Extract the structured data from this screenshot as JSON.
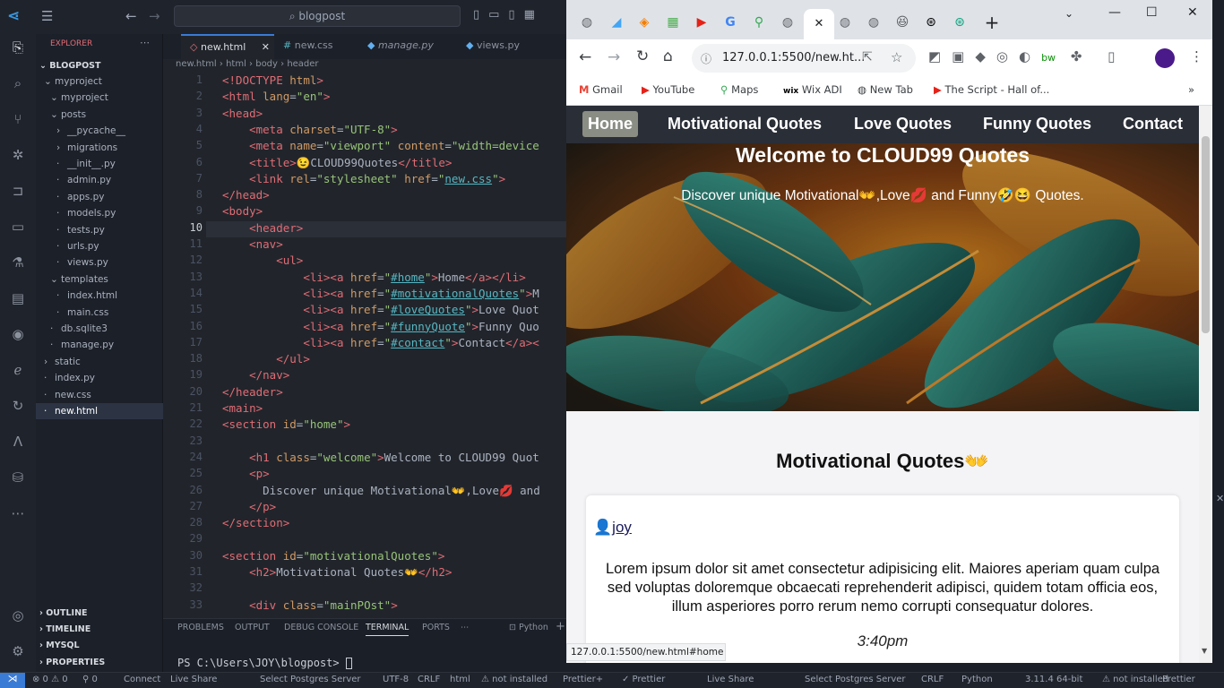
{
  "vscode": {
    "tabs": [
      "new.html",
      "new.css",
      "manage.py",
      "views.py"
    ],
    "breadcrumb": [
      "new.html",
      "html",
      "body",
      "header"
    ],
    "explorer_title": "EXPLORER",
    "project": "BLOGPOST",
    "tree": [
      "myproject",
      "myproject",
      "posts",
      "__pycache__",
      "migrations",
      "__init__.py",
      "admin.py",
      "apps.py",
      "models.py",
      "tests.py",
      "urls.py",
      "views.py",
      "templates",
      "index.html",
      "main.css",
      "db.sqlite3",
      "manage.py",
      "static",
      "index.py",
      "new.css",
      "new.html"
    ],
    "sections": [
      "OUTLINE",
      "TIMELINE",
      "MYSQL",
      "PROPERTIES"
    ],
    "panel_tabs": [
      "PROBLEMS",
      "OUTPUT",
      "DEBUG CONSOLE",
      "TERMINAL",
      "PORTS"
    ],
    "terminal_shell": "Python",
    "terminal_prompt": "PS C:\\Users\\JOY\\blogpost> ",
    "code": [
      {
        "n": "1",
        "t": [
          [
            "tg",
            "<!DOCTYPE "
          ],
          [
            "at",
            "html"
          ],
          [
            "tg",
            ">"
          ]
        ]
      },
      {
        "n": "2",
        "t": [
          [
            "tg",
            "<html "
          ],
          [
            "at",
            "lang"
          ],
          [
            "tx",
            "="
          ],
          [
            "st",
            "\"en\""
          ],
          [
            "tg",
            ">"
          ]
        ]
      },
      {
        "n": "3",
        "t": [
          [
            "tg",
            "<head>"
          ]
        ]
      },
      {
        "n": "4",
        "t": [
          [
            "tx",
            "    "
          ],
          [
            "tg",
            "<meta "
          ],
          [
            "at",
            "charset"
          ],
          [
            "tx",
            "="
          ],
          [
            "st",
            "\"UTF-8\""
          ],
          [
            "tg",
            ">"
          ]
        ]
      },
      {
        "n": "5",
        "t": [
          [
            "tx",
            "    "
          ],
          [
            "tg",
            "<meta "
          ],
          [
            "at",
            "name"
          ],
          [
            "tx",
            "="
          ],
          [
            "st",
            "\"viewport\""
          ],
          [
            "tx",
            " "
          ],
          [
            "at",
            "content"
          ],
          [
            "tx",
            "="
          ],
          [
            "st",
            "\"width=device"
          ]
        ]
      },
      {
        "n": "6",
        "t": [
          [
            "tx",
            "    "
          ],
          [
            "tg",
            "<title>"
          ],
          [
            "tx",
            "😉CLOUD99Quotes"
          ],
          [
            "tg",
            "</title>"
          ]
        ]
      },
      {
        "n": "7",
        "t": [
          [
            "tx",
            "    "
          ],
          [
            "tg",
            "<link "
          ],
          [
            "at",
            "rel"
          ],
          [
            "tx",
            "="
          ],
          [
            "st",
            "\"stylesheet\""
          ],
          [
            "tx",
            " "
          ],
          [
            "at",
            "href"
          ],
          [
            "tx",
            "="
          ],
          [
            "st",
            "\""
          ],
          [
            "lk",
            "new.css"
          ],
          [
            "st",
            "\""
          ],
          [
            "tg",
            ">"
          ]
        ]
      },
      {
        "n": "8",
        "t": [
          [
            "tg",
            "</head>"
          ]
        ]
      },
      {
        "n": "9",
        "t": [
          [
            "tg",
            "<body>"
          ]
        ]
      },
      {
        "n": "10",
        "t": [
          [
            "tx",
            "    "
          ],
          [
            "tg",
            "<header>"
          ]
        ],
        "cur": true
      },
      {
        "n": "11",
        "t": [
          [
            "tx",
            "    "
          ],
          [
            "tg",
            "<nav>"
          ]
        ]
      },
      {
        "n": "12",
        "t": [
          [
            "tx",
            "        "
          ],
          [
            "tg",
            "<ul>"
          ]
        ]
      },
      {
        "n": "13",
        "t": [
          [
            "tx",
            "            "
          ],
          [
            "tg",
            "<li><a "
          ],
          [
            "at",
            "href"
          ],
          [
            "tx",
            "="
          ],
          [
            "st",
            "\""
          ],
          [
            "lk",
            "#home"
          ],
          [
            "st",
            "\""
          ],
          [
            "tg",
            ">"
          ],
          [
            "tx",
            "Home"
          ],
          [
            "tg",
            "</a></li>"
          ]
        ]
      },
      {
        "n": "14",
        "t": [
          [
            "tx",
            "            "
          ],
          [
            "tg",
            "<li><a "
          ],
          [
            "at",
            "href"
          ],
          [
            "tx",
            "="
          ],
          [
            "st",
            "\""
          ],
          [
            "lk",
            "#motivationalQuotes"
          ],
          [
            "st",
            "\""
          ],
          [
            "tg",
            ">"
          ],
          [
            "tx",
            "M"
          ]
        ]
      },
      {
        "n": "15",
        "t": [
          [
            "tx",
            "            "
          ],
          [
            "tg",
            "<li><a "
          ],
          [
            "at",
            "href"
          ],
          [
            "tx",
            "="
          ],
          [
            "st",
            "\""
          ],
          [
            "lk",
            "#loveQuotes"
          ],
          [
            "st",
            "\""
          ],
          [
            "tg",
            ">"
          ],
          [
            "tx",
            "Love Quot"
          ]
        ]
      },
      {
        "n": "16",
        "t": [
          [
            "tx",
            "            "
          ],
          [
            "tg",
            "<li><a "
          ],
          [
            "at",
            "href"
          ],
          [
            "tx",
            "="
          ],
          [
            "st",
            "\""
          ],
          [
            "lk",
            "#funnyQuote"
          ],
          [
            "st",
            "\""
          ],
          [
            "tg",
            ">"
          ],
          [
            "tx",
            "Funny Quo"
          ]
        ]
      },
      {
        "n": "17",
        "t": [
          [
            "tx",
            "            "
          ],
          [
            "tg",
            "<li><a "
          ],
          [
            "at",
            "href"
          ],
          [
            "tx",
            "="
          ],
          [
            "st",
            "\""
          ],
          [
            "lk",
            "#contact"
          ],
          [
            "st",
            "\""
          ],
          [
            "tg",
            ">"
          ],
          [
            "tx",
            "Contact"
          ],
          [
            "tg",
            "</a><"
          ]
        ]
      },
      {
        "n": "18",
        "t": [
          [
            "tx",
            "        "
          ],
          [
            "tg",
            "</ul>"
          ]
        ]
      },
      {
        "n": "19",
        "t": [
          [
            "tx",
            "    "
          ],
          [
            "tg",
            "</nav>"
          ]
        ]
      },
      {
        "n": "20",
        "t": [
          [
            "tg",
            "</header>"
          ]
        ]
      },
      {
        "n": "21",
        "t": [
          [
            "tg",
            "<main>"
          ]
        ]
      },
      {
        "n": "22",
        "t": [
          [
            "tg",
            "<section "
          ],
          [
            "at",
            "id"
          ],
          [
            "tx",
            "="
          ],
          [
            "st",
            "\"home\""
          ],
          [
            "tg",
            ">"
          ]
        ]
      },
      {
        "n": "23",
        "t": []
      },
      {
        "n": "24",
        "t": [
          [
            "tx",
            "    "
          ],
          [
            "tg",
            "<h1 "
          ],
          [
            "at",
            "class"
          ],
          [
            "tx",
            "="
          ],
          [
            "st",
            "\"welcome\""
          ],
          [
            "tg",
            ">"
          ],
          [
            "tx",
            "Welcome to CLOUD99 Quot"
          ]
        ]
      },
      {
        "n": "25",
        "t": [
          [
            "tx",
            "    "
          ],
          [
            "tg",
            "<p>"
          ]
        ]
      },
      {
        "n": "26",
        "t": [
          [
            "tx",
            "      Discover unique Motivational👐,Love💋 and"
          ]
        ]
      },
      {
        "n": "27",
        "t": [
          [
            "tx",
            "    "
          ],
          [
            "tg",
            "</p>"
          ]
        ]
      },
      {
        "n": "28",
        "t": [
          [
            "tg",
            "</section>"
          ]
        ]
      },
      {
        "n": "29",
        "t": []
      },
      {
        "n": "30",
        "t": [
          [
            "tg",
            "<section "
          ],
          [
            "at",
            "id"
          ],
          [
            "tx",
            "="
          ],
          [
            "st",
            "\"motivationalQuotes\""
          ],
          [
            "tg",
            ">"
          ]
        ]
      },
      {
        "n": "31",
        "t": [
          [
            "tx",
            "    "
          ],
          [
            "tg",
            "<h2>"
          ],
          [
            "tx",
            "Motivational Quotes👐"
          ],
          [
            "tg",
            "</h2>"
          ]
        ]
      },
      {
        "n": "32",
        "t": []
      },
      {
        "n": "33",
        "t": [
          [
            "tx",
            "    "
          ],
          [
            "tg",
            "<div "
          ],
          [
            "at",
            "class"
          ],
          [
            "tx",
            "="
          ],
          [
            "st",
            "\"mainPOst\""
          ],
          [
            "tg",
            ">"
          ]
        ]
      }
    ],
    "status": [
      "⊗ 0 ⚠ 0",
      "⚲ 0",
      "Connect",
      "Live Share",
      "Select Postgres Server",
      "UTF-8",
      "CRLF",
      "html",
      "⚠ not installed",
      "Prettier+",
      "✓ Prettier",
      "Live Share",
      "Select Postgres Server",
      "CRLF",
      "Python",
      "3.11.4 64-bit",
      "⚠ not installed",
      "Prettier"
    ]
  },
  "browser": {
    "url": "127.0.0.1:5500/new.ht...",
    "bookmarks": [
      "Gmail",
      "YouTube",
      "Maps",
      "Wix ADI",
      "New Tab",
      "The Script - Hall of..."
    ],
    "nav": [
      "Home",
      "Motivational Quotes",
      "Love Quotes",
      "Funny Quotes",
      "Contact"
    ],
    "hero_title": "Welcome to CLOUD99 Quotes",
    "hero_sub": "Discover unique Motivational👐,Love💋 and Funny🤣😆 Quotes.",
    "section_title": "Motivational Quotes👐",
    "author": "joy",
    "quote": "Lorem ipsum dolor sit amet consectetur adipisicing elit. Maiores aperiam quam culpa sed voluptas doloremque obcaecati reprehenderit adipisci, quidem totam officia eos, illum asperiores porro rerum nemo corrupti consequatur dolores.",
    "time": "3:40pm",
    "status_url": "127.0.0.1:5500/new.html#home"
  }
}
